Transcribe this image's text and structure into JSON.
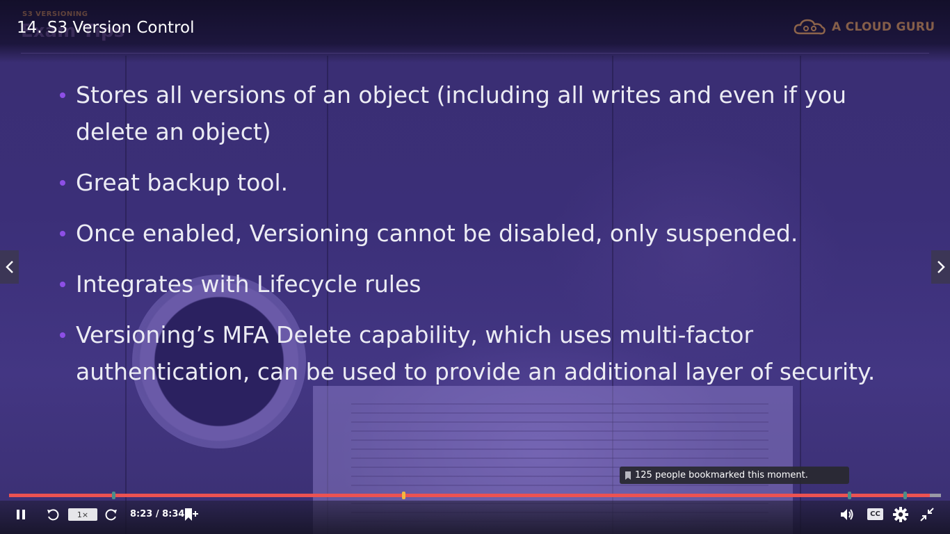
{
  "window": {
    "lecture_title": "14. S3 Version Control"
  },
  "slide": {
    "kicker": "S3 VERSIONING",
    "heading": "Exam Tips",
    "brand": "A CLOUD GURU",
    "bullets": [
      "Stores all versions of an object (including all writes and even if you delete an object)",
      "Great backup tool.",
      "Once enabled, Versioning cannot be disabled, only suspended.",
      "Integrates with Lifecycle rules",
      "Versioning’s MFA Delete capability, which uses multi-factor authentication, can be used to provide an additional layer of security."
    ]
  },
  "tooltip": {
    "text": "125 people bookmarked this moment."
  },
  "player": {
    "progress_fraction": 0.988,
    "speed_label": "1×",
    "time_label": "8:23 / 8:34",
    "cc_label": "CC",
    "colors": {
      "progress": "#ec5252",
      "track": "#9a9aa6",
      "marker": "#4b8d8a",
      "marker_current": "#f4b73f"
    },
    "icons": {
      "pause": "pause-icon",
      "rewind": "rewind-5s-icon",
      "forward": "forward-5s-icon",
      "bookmark": "add-bookmark-icon",
      "volume": "volume-icon",
      "captions": "cc-icon",
      "settings": "gear-icon",
      "fullscreen": "exit-fullscreen-icon",
      "prev": "chevron-left-icon",
      "next": "chevron-right-icon"
    }
  }
}
